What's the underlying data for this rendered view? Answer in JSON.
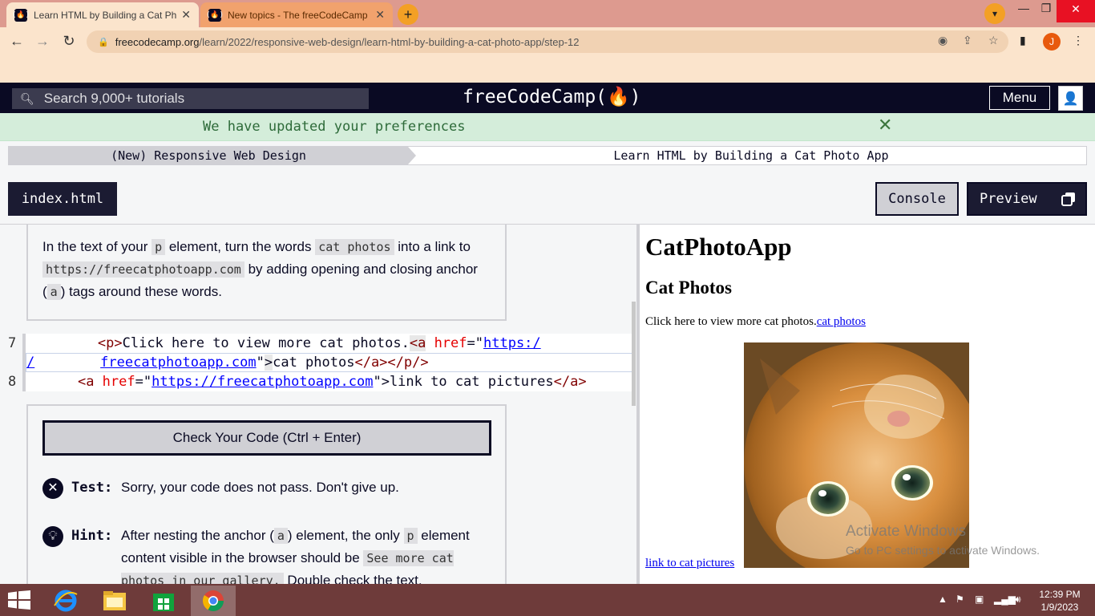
{
  "browser": {
    "tabs": [
      {
        "title": "Learn HTML by Building a Cat Ph",
        "active": true
      },
      {
        "title": "New topics - The freeCodeCamp",
        "active": false
      }
    ],
    "new_tab": "+",
    "url_host": "freecodecamp.org",
    "url_path": "/learn/2022/responsive-web-design/learn-html-by-building-a-cat-photo-app/step-12",
    "profile_initial": "J",
    "colors": {
      "tabbar": "#dd9a8f",
      "toolbar": "#fbe4cc",
      "accent": "#f3a025"
    }
  },
  "fcc": {
    "search_placeholder": "Search 9,000+ tutorials",
    "logo": "freeCodeCamp(🔥)",
    "menu_label": "Menu",
    "flash_message": "We have updated your preferences",
    "breadcrumb": {
      "superblock": "(New) Responsive Web Design",
      "block": "Learn HTML by Building a Cat Photo App"
    },
    "file_tab": "index.html",
    "console_label": "Console",
    "preview_label": "Preview"
  },
  "instructions": {
    "t1": "In the text of your ",
    "c1": "p",
    "t2": " element, turn the words ",
    "c2": "cat photos",
    "t3": " into a link to ",
    "c3": "https://freecatphotoapp.com",
    "t4": " by adding opening and closing anchor (",
    "c4": "a",
    "t5": ") tags around these words."
  },
  "editor": {
    "line7": "7",
    "line8": "8",
    "l7a_indent": "        ",
    "l7a_tag_open": "<p>",
    "l7a_text": "Click here to view more cat photos.",
    "l7a_a": "<a",
    "l7a_attr": " href",
    "l7a_eq": "=\"",
    "l7a_str": "https:/",
    "l7b_slash": "/",
    "l7b_indent": "        ",
    "l7b_str": "freecatphotoapp.com",
    "l7b_quote": "\"",
    "l7b_gt": ">",
    "l7b_text": "cat photos",
    "l7b_close": "</a></p/>",
    "l8_indent": "    ",
    "l8_a": "<a",
    "l8_attr": " href",
    "l8_eq": "=\"",
    "l8_str": "https://freecatphotoapp.com",
    "l8_quote": "\">",
    "l8_text": "link to cat pictures",
    "l8_close": "</a>"
  },
  "tests": {
    "check_button": "Check Your Code (Ctrl + Enter)",
    "test_label": "Test:",
    "test_text": "Sorry, your code does not pass. Don't give up.",
    "hint_label": "Hint:",
    "hint_t1": "After nesting the anchor (",
    "hint_c1": "a",
    "hint_t2": ") element, the only ",
    "hint_c2": "p",
    "hint_t3": " element content visible in the browser should be ",
    "hint_c3": "See more cat photos in our gallery.",
    "hint_t4": " Double check the text,"
  },
  "preview": {
    "h1": "CatPhotoApp",
    "h2": "Cat Photos",
    "p_text": "Click here to view more cat photos.",
    "p_link": "cat photos",
    "link2": "link to cat pictures"
  },
  "watermark": {
    "line1": "Activate Windows",
    "line2": "Go to PC settings to activate Windows."
  },
  "taskbar": {
    "time": "12:39 PM",
    "date": "1/9/2023"
  }
}
